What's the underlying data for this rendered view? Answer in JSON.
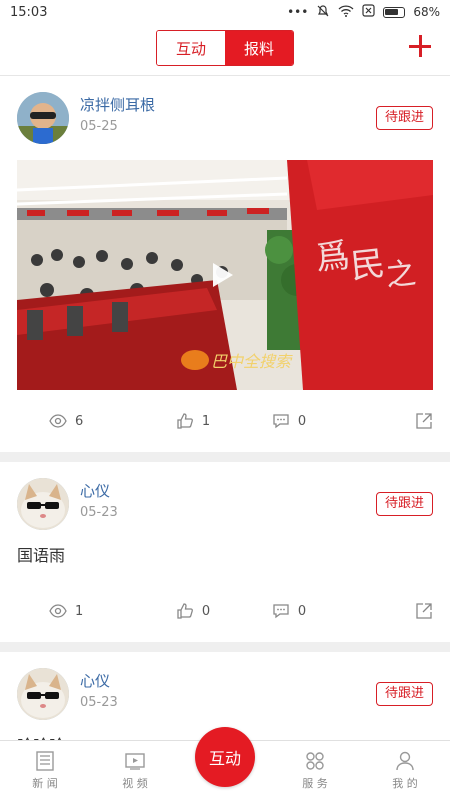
{
  "status": {
    "time": "15:03",
    "battery": "68%"
  },
  "header": {
    "tabs": [
      {
        "label": "互动"
      },
      {
        "label": "报料"
      }
    ]
  },
  "posts": [
    {
      "name": "凉拌侧耳根",
      "date": "05-25",
      "badge": "待跟进",
      "text": "",
      "has_video": true,
      "video_watermark": "巴中全搜索",
      "views": "6",
      "likes": "1",
      "comments": "0"
    },
    {
      "name": "心仪",
      "date": "05-23",
      "badge": "待跟进",
      "text": "国语雨",
      "views": "1",
      "likes": "0",
      "comments": "0"
    },
    {
      "name": "心仪",
      "date": "05-23",
      "badge": "待跟进",
      "text": "哈哈哈"
    }
  ],
  "tabbar": {
    "items": [
      {
        "label": "新 闻",
        "icon": "newspaper-icon"
      },
      {
        "label": "视 频",
        "icon": "video-icon"
      },
      {
        "label": "互动",
        "icon": "center"
      },
      {
        "label": "服 务",
        "icon": "grid-icon"
      },
      {
        "label": "我 的",
        "icon": "user-icon"
      }
    ]
  }
}
